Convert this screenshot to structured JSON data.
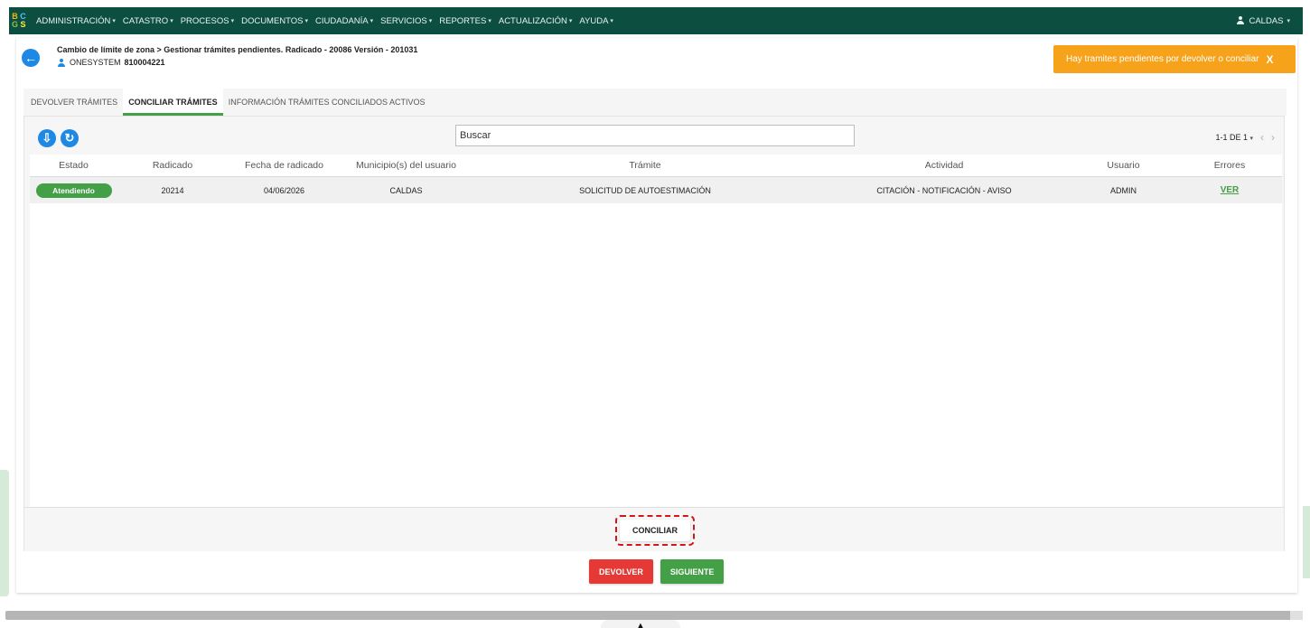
{
  "nav": {
    "logo_letters": [
      "B",
      "C",
      "G",
      "S"
    ],
    "items": [
      {
        "label": "ADMINISTRACIÓN"
      },
      {
        "label": "CATASTRO"
      },
      {
        "label": "PROCESOS"
      },
      {
        "label": "DOCUMENTOS"
      },
      {
        "label": "CIUDADANÍA"
      },
      {
        "label": "SERVICIOS"
      },
      {
        "label": "REPORTES"
      },
      {
        "label": "ACTUALIZACIÓN"
      },
      {
        "label": "AYUDA"
      }
    ],
    "user_label": "CALDAS"
  },
  "header": {
    "title": "Cambio de límite de zona > Gestionar trámites pendientes. Radicado - 20086 Versión - 201031",
    "subtitle_label": "ONESYSTEM",
    "subtitle_value": "810004221"
  },
  "alert": {
    "text": "Hay tramites pendientes por devolver o conciliar",
    "close": "X",
    "color": "#f7a21b"
  },
  "tabs": [
    {
      "label": "DEVOLVER TRÁMITES",
      "active": false
    },
    {
      "label": "CONCILIAR TRÁMITES",
      "active": true
    },
    {
      "label": "INFORMACIÓN TRÁMITES CONCILIADOS ACTIVOS",
      "active": false
    }
  ],
  "toolbar": {
    "search_value": "Buscar",
    "pager_text": "1-1 DE 1",
    "prev": "‹",
    "next": "›"
  },
  "table": {
    "columns": [
      "Estado",
      "Radicado",
      "Fecha de radicado",
      "Municipio(s) del usuario",
      "Trámite",
      "Actividad",
      "Usuario",
      "Errores"
    ],
    "rows": [
      {
        "estado": "Atendiendo",
        "radicado": "20214",
        "fecha": "04/06/2026",
        "municipio": "CALDAS",
        "tramite": "SOLICITUD DE AUTOESTIMACIÓN",
        "actividad": "CITACIÓN - NOTIFICACIÓN - AVISO",
        "usuario": "ADMIN",
        "errores": "VER"
      }
    ]
  },
  "buttons": {
    "conciliar": "CONCILIAR",
    "devolver": "DEVOLVER",
    "siguiente": "SIGUIENTE"
  },
  "colors": {
    "nav_bg": "#0c4f40",
    "primary_blue": "#1e88e5",
    "success_green": "#43a047",
    "danger_red": "#e53935"
  }
}
